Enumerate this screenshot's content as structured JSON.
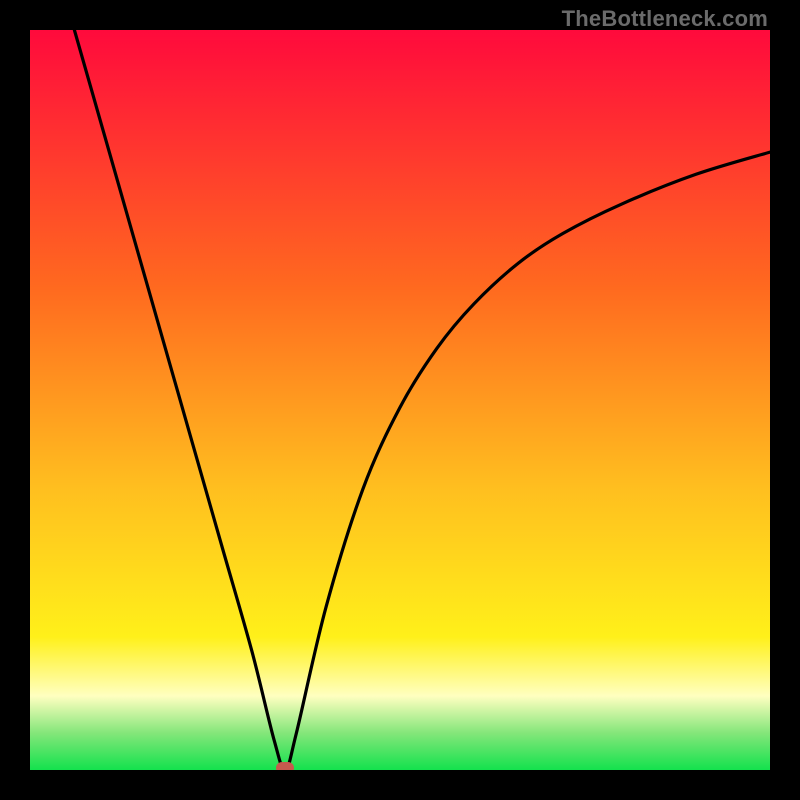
{
  "watermark": "TheBottleneck.com",
  "colors": {
    "top": "#ff0a3c",
    "upper_mid": "#ff6a1f",
    "mid": "#ffbf1f",
    "lower_mid": "#fff01a",
    "pale": "#ffffc0",
    "green_light": "#84e67a",
    "green": "#13e24d",
    "frame": "#000000",
    "curve": "#000000",
    "marker": "#c65a4e"
  },
  "chart_data": {
    "type": "line",
    "title": "",
    "xlabel": "",
    "ylabel": "",
    "xlim": [
      0,
      100
    ],
    "ylim": [
      0,
      100
    ],
    "grid": false,
    "legend": false,
    "series": [
      {
        "name": "bottleneck-curve",
        "x": [
          6,
          10,
          14,
          18,
          22,
          26,
          30,
          33,
          34.5,
          36,
          40,
          45,
          50,
          55,
          60,
          66,
          72,
          80,
          90,
          100
        ],
        "values": [
          100,
          86,
          72,
          58,
          44,
          30,
          16,
          4,
          0,
          5,
          22,
          38,
          49,
          57,
          63,
          68.5,
          72.5,
          76.5,
          80.5,
          83.5
        ]
      }
    ],
    "annotations": [
      {
        "name": "minimum-marker",
        "x": 34.5,
        "y": 0
      }
    ],
    "gradient_stops": [
      {
        "pos": 0.0,
        "label": "red"
      },
      {
        "pos": 0.35,
        "label": "orange"
      },
      {
        "pos": 0.62,
        "label": "gold"
      },
      {
        "pos": 0.82,
        "label": "yellow"
      },
      {
        "pos": 0.9,
        "label": "pale-yellow"
      },
      {
        "pos": 0.95,
        "label": "light-green"
      },
      {
        "pos": 1.0,
        "label": "green"
      }
    ]
  }
}
